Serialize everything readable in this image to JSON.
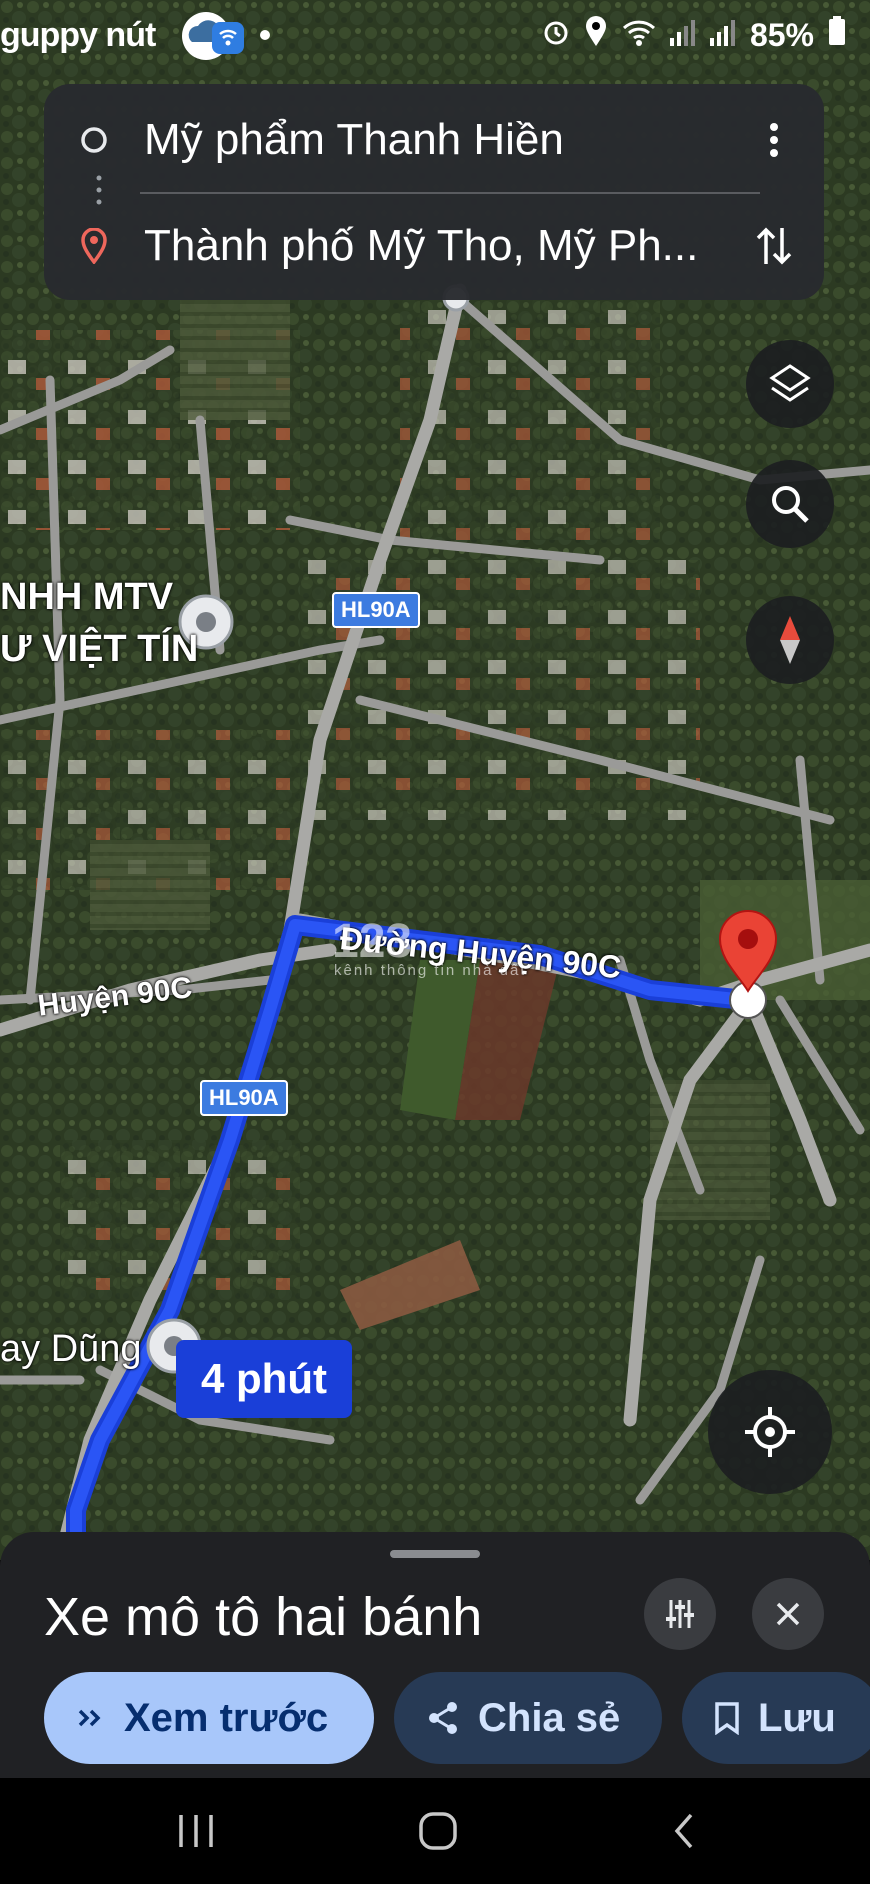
{
  "status_bar": {
    "left_text": "guppy nút",
    "battery": "85%",
    "icons": [
      "cloud-icon",
      "wifi-calling-icon",
      "dot-icon",
      "alarm-icon",
      "location-icon",
      "wifi-icon",
      "signal-icon",
      "signal-icon",
      "battery-icon"
    ]
  },
  "route": {
    "origin": "Mỹ phẩm Thanh Hiền",
    "destination": "Thành phố Mỹ Tho, Mỹ Ph...",
    "more_icon": "more-vert-icon",
    "swap_icon": "swap-vertical-icon"
  },
  "map": {
    "labels": {
      "business_line1": "NHH MTV",
      "business_line2": "Ư VIỆT TÍN",
      "road_left": "Huyện 90C",
      "road_main": "Đường Huyện 90C",
      "shield_top": "HL90A",
      "shield_bottom": "HL90A",
      "place_bottom": "ay Dũng"
    },
    "eta": "4 phút",
    "watermark": "123",
    "watermark_sub": "kênh thông tin nhà đất",
    "route_color": "#1a3fd8",
    "controls": [
      "layers-icon",
      "search-icon",
      "compass-icon",
      "my-location-icon"
    ]
  },
  "sheet": {
    "title": "Xe mô tô hai bánh",
    "buttons": {
      "preview": "Xem trước",
      "share": "Chia sẻ",
      "save": "Lưu"
    },
    "accent": "#a8c7fa"
  }
}
